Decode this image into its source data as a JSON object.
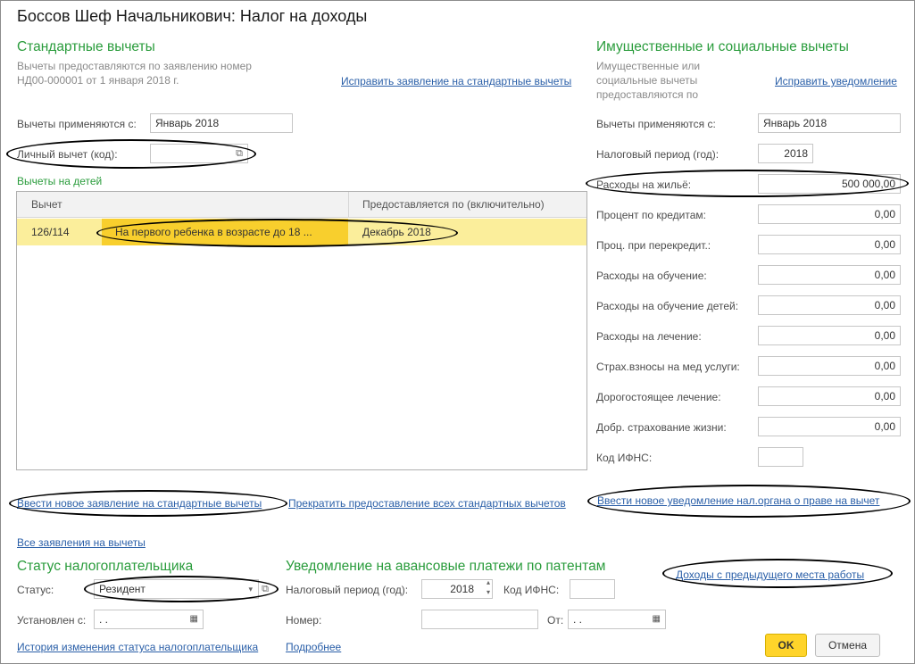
{
  "window": {
    "title": "Боссов Шеф Начальникович: Налог на доходы"
  },
  "standard": {
    "heading": "Стандартные вычеты",
    "note_line1": "Вычеты предоставляются по заявлению номер",
    "note_line2": "НД00-000001 от 1 января 2018 г.",
    "fix_link": "Исправить заявление на стандартные вычеты",
    "apply_from_label": "Вычеты применяются с:",
    "apply_from_value": "Январь 2018",
    "personal_label": "Личный вычет (код):",
    "personal_value": "",
    "children_title": "Вычеты на детей",
    "table": {
      "col_deduction": "Вычет",
      "col_until": "Предоставляется по (включительно)",
      "row_code": "126/114",
      "row_desc": "На первого ребенка в возрасте до 18 ...",
      "row_until": "Декабрь 2018"
    },
    "new_app_link": "Ввести новое заявление на стандартные вычеты",
    "stop_link": "Прекратить предоставление всех стандартных вычетов",
    "all_apps_link": "Все заявления на вычеты"
  },
  "property": {
    "heading": "Имущественные и социальные вычеты",
    "note_line1": "Имущественные или",
    "note_line2": "социальные вычеты",
    "note_line3": "предоставляются по",
    "fix_link": "Исправить уведомление",
    "apply_from_label": "Вычеты применяются с:",
    "apply_from_value": "Январь 2018",
    "period_label": "Налоговый период (год):",
    "period_value": "2018",
    "housing_label": "Расходы на жильё:",
    "housing_value": "500 000,00",
    "credit_label": "Процент по кредитам:",
    "credit_value": "0,00",
    "refin_label": "Проц. при перекредит.:",
    "refin_value": "0,00",
    "edu_label": "Расходы на обучение:",
    "edu_value": "0,00",
    "edu_kids_label": "Расходы на обучение детей:",
    "edu_kids_value": "0,00",
    "med_label": "Расходы на лечение:",
    "med_value": "0,00",
    "ins_label": "Страх.взносы на мед услуги:",
    "ins_value": "0,00",
    "expmed_label": "Дорогостоящее лечение:",
    "expmed_value": "0,00",
    "life_label": "Добр. страхование жизни:",
    "life_value": "0,00",
    "ifns_label": "Код ИФНС:",
    "ifns_value": "",
    "new_notice_link": "Ввести новое уведомление нал.органа о праве на вычет"
  },
  "status": {
    "heading": "Статус налогоплательщика",
    "status_label": "Статус:",
    "status_value": "Резидент",
    "set_label": "Установлен с:",
    "set_value": " .  .",
    "history_link": "История изменения статуса налогоплательщика"
  },
  "patent": {
    "heading": "Уведомление на авансовые платежи по патентам",
    "period_label": "Налоговый период (год):",
    "period_value": "2018",
    "ifns_label": "Код ИФНС:",
    "ifns_value": "",
    "number_label": "Номер:",
    "number_value": "",
    "from_label": "От:",
    "from_value": " .  .",
    "more_link": "Подробнее"
  },
  "prev_income_link": "Доходы с предыдущего места работы",
  "buttons": {
    "ok": "OK",
    "cancel": "Отмена"
  }
}
